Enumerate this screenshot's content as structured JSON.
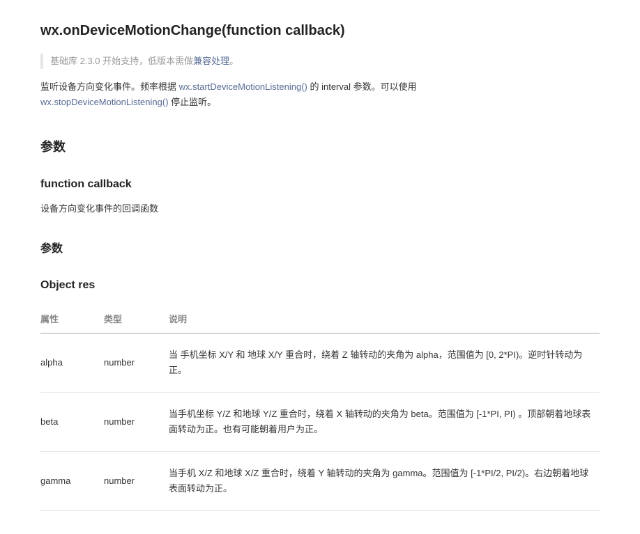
{
  "title": "wx.onDeviceMotionChange(function callback)",
  "support_note": {
    "prefix": "基础库 2.3.0 开始支持，低版本需做",
    "link": "兼容处理",
    "suffix": "。"
  },
  "description": {
    "part1": "监听设备方向变化事件。频率根据 ",
    "link1": "wx.startDeviceMotionListening()",
    "part2": " 的 interval 参数。可以使用 ",
    "link2": "wx.stopDeviceMotionListening()",
    "part3": " 停止监听。"
  },
  "params_heading": "参数",
  "callback_heading": "function callback",
  "callback_desc": "设备方向变化事件的回调函数",
  "callback_params_heading": "参数",
  "object_heading": "Object res",
  "table": {
    "headers": [
      "属性",
      "类型",
      "说明"
    ],
    "rows": [
      {
        "name": "alpha",
        "type": "number",
        "desc": "当 手机坐标 X/Y 和 地球 X/Y 重合时，绕着 Z 轴转动的夹角为 alpha，范围值为 [0, 2*PI)。逆时针转动为正。"
      },
      {
        "name": "beta",
        "type": "number",
        "desc": "当手机坐标 Y/Z 和地球 Y/Z 重合时，绕着 X 轴转动的夹角为 beta。范围值为 [-1*PI, PI) 。顶部朝着地球表面转动为正。也有可能朝着用户为正。"
      },
      {
        "name": "gamma",
        "type": "number",
        "desc": "当手机 X/Z 和地球 X/Z 重合时，绕着 Y 轴转动的夹角为 gamma。范围值为 [-1*PI/2, PI/2)。右边朝着地球表面转动为正。"
      }
    ]
  }
}
